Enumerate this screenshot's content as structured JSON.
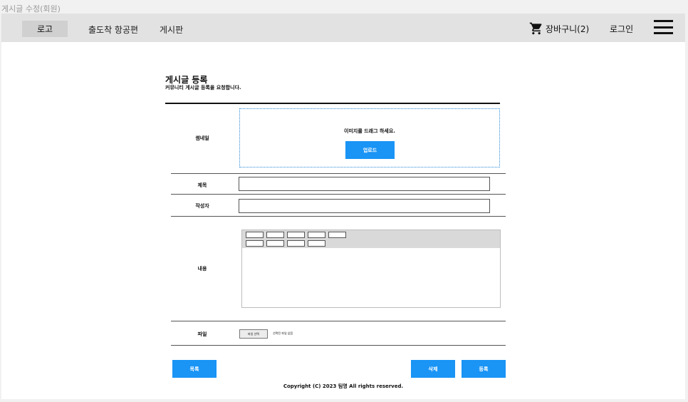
{
  "window": {
    "title": "게시글 수정(회원)"
  },
  "nav": {
    "logo": "로고",
    "links": [
      "출도착 항공편",
      "게시판"
    ],
    "cart_label": "장바구니(2)",
    "login_label": "로그인",
    "menu_icon": "hamburger-icon",
    "cart_icon": "cart-icon"
  },
  "page": {
    "title": "게시글 등록",
    "subtitle": "커뮤니티 게시글 등록을 요청합니다."
  },
  "form": {
    "thumbnail_label": "썸네일",
    "drop_text": "이미지를 드래그 하세요.",
    "upload_button": "업로드",
    "title_label": "제목",
    "title_value": "",
    "author_label": "작성자",
    "author_value": "",
    "content_label": "내용",
    "file_label": "파일",
    "file_button": "파일 선택",
    "file_none": "선택된 파일 없음"
  },
  "actions": {
    "list_button": "목록",
    "delete_button": "삭제",
    "submit_button": "등록"
  },
  "footer": {
    "copyright": "Copyright (C) 2023 팀명 All rights reserved."
  },
  "colors": {
    "accent": "#1a94f5",
    "nav_bg": "#e2e2e2"
  }
}
